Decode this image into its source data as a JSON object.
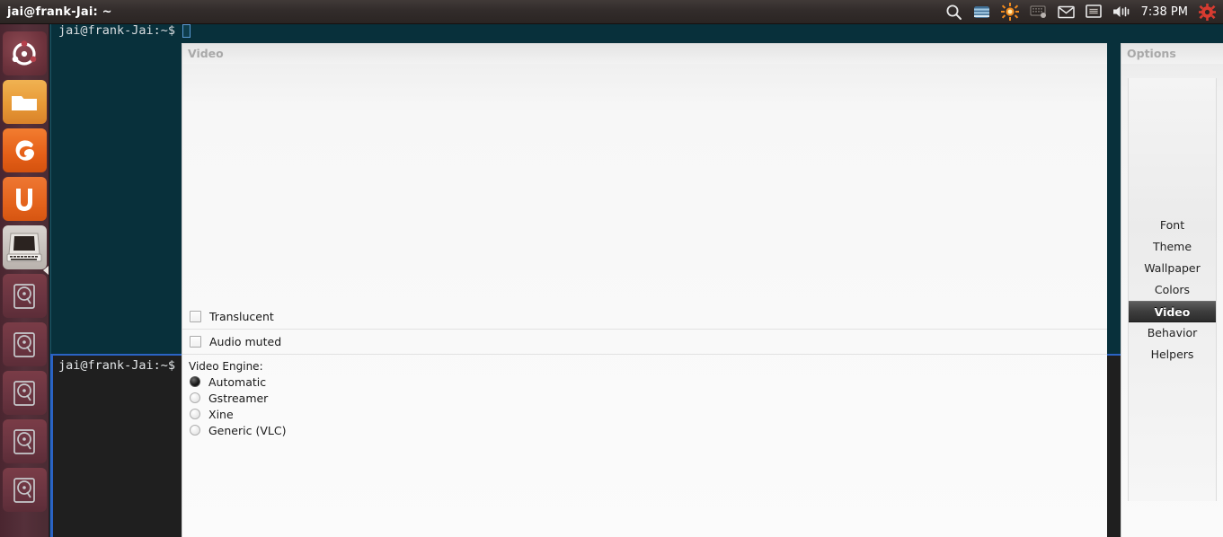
{
  "topbar": {
    "title": "jai@frank-Jai: ~",
    "clock": "7:38 PM",
    "tray_icons": [
      {
        "name": "search-icon",
        "label": "search"
      },
      {
        "name": "workspace-switcher-icon",
        "label": "workspaces"
      },
      {
        "name": "sun-settings-icon",
        "label": "settings"
      },
      {
        "name": "keyboard-indicator-icon",
        "label": "keyboard"
      },
      {
        "name": "mail-icon",
        "label": "messaging"
      },
      {
        "name": "display-icon",
        "label": "display"
      },
      {
        "name": "volume-icon",
        "label": "sound"
      }
    ],
    "session_icon": "gear-icon"
  },
  "launcher": {
    "items": [
      {
        "name": "ubuntu-dash-icon",
        "label": "Dash home"
      },
      {
        "name": "files-icon",
        "label": "Files"
      },
      {
        "name": "firefox-icon",
        "label": "Firefox Web Browser"
      },
      {
        "name": "ubuntu-software-icon",
        "label": "Ubuntu Software Center"
      },
      {
        "name": "terminal-icon",
        "label": "Terminal"
      },
      {
        "name": "disk-icon",
        "label": "Disk"
      },
      {
        "name": "disk-icon",
        "label": "Disk"
      },
      {
        "name": "disk-icon",
        "label": "Disk"
      },
      {
        "name": "disk-icon",
        "label": "Disk"
      },
      {
        "name": "disk-icon",
        "label": "Disk"
      }
    ]
  },
  "terminal_top": {
    "prompt": "jai@frank-Jai:~$"
  },
  "terminal_bottom": {
    "prompt": "jai@frank-Jai:~$"
  },
  "video_panel": {
    "header": "Video",
    "checkboxes": [
      {
        "label": "Translucent",
        "checked": false
      },
      {
        "label": "Audio muted",
        "checked": false
      }
    ],
    "engine_group_label": "Video Engine:",
    "engines": [
      {
        "label": "Automatic",
        "selected": true
      },
      {
        "label": "Gstreamer",
        "selected": false
      },
      {
        "label": "Xine",
        "selected": false
      },
      {
        "label": "Generic (VLC)",
        "selected": false
      }
    ]
  },
  "options_panel": {
    "header": "Options",
    "items": [
      {
        "label": "Font",
        "selected": false
      },
      {
        "label": "Theme",
        "selected": false
      },
      {
        "label": "Wallpaper",
        "selected": false
      },
      {
        "label": "Colors",
        "selected": false
      },
      {
        "label": "Video",
        "selected": true
      },
      {
        "label": "Behavior",
        "selected": false
      },
      {
        "label": "Helpers",
        "selected": false
      }
    ]
  },
  "colors": {
    "topbar_bg": "#322c2b",
    "launcher_bg": "#55303a",
    "terminal_top_bg": "#08303b",
    "terminal_bottom_bg": "#1f1f1f",
    "focus_border": "#2b63c4",
    "panel_bg": "#f7f7f7",
    "selection_bg": "#3d3d3d",
    "accent_orange": "#e4631c",
    "session_red": "#d93b30"
  }
}
